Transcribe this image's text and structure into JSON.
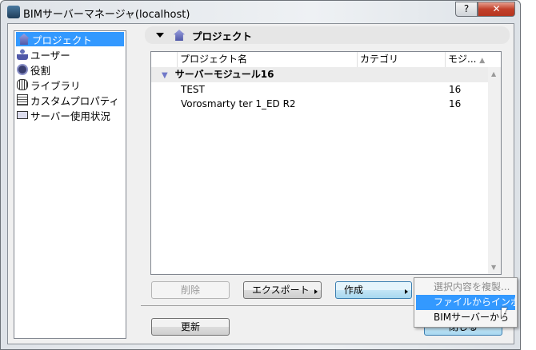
{
  "window": {
    "title": "BIMサーバーマネージャ(localhost)",
    "help": "?",
    "close": "✕"
  },
  "sidebar": {
    "items": [
      {
        "label": "プロジェクト",
        "icon": "house-icon"
      },
      {
        "label": "ユーザー",
        "icon": "user-icon"
      },
      {
        "label": "役割",
        "icon": "role-icon"
      },
      {
        "label": "ライブラリ",
        "icon": "library-icon"
      },
      {
        "label": "カスタムプロパティ",
        "icon": "properties-icon"
      },
      {
        "label": "サーバー使用状況",
        "icon": "usage-icon"
      }
    ]
  },
  "header": {
    "title": "プロジェクト"
  },
  "table": {
    "columns": [
      "プロジェクト名",
      "カテゴリ",
      "モジ..."
    ],
    "group": "サーバーモジュール16",
    "rows": [
      {
        "name": "TEST",
        "category": "",
        "module": "16"
      },
      {
        "name": "Vorosmarty ter 1_ED R2",
        "category": "",
        "module": "16"
      }
    ]
  },
  "buttons": {
    "delete": "削除",
    "export": "エクスポート",
    "create": "作成",
    "refresh": "更新",
    "close": "閉じる"
  },
  "menu": {
    "items": [
      "選択内容を複製...",
      "ファイルからインポ...",
      "BIMサーバーから"
    ]
  }
}
